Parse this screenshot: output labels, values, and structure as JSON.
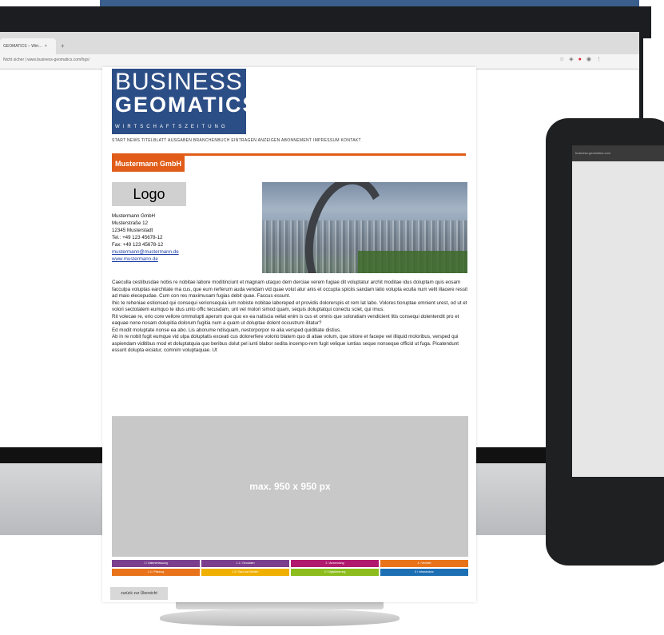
{
  "browser": {
    "tab_title": "GEOMATICS – Wirt…",
    "new_tab_glyph": "+",
    "url": "Nicht sicher  |  www.business-geomatics.com/hgs/"
  },
  "tablet": {
    "url": "business-geomatics.com"
  },
  "site": {
    "logo_line1": "BUSINESS",
    "logo_line2": "GEOMATICS",
    "logo_line3": "WIRTSCHAFTSZEITUNG",
    "nav": "START  NEWS  TITELBLATT  AUSGABEN  BRANCHENBUCH  EINTRAGEN  ANZEIGEN  ABONNEMENT  IMPRESSUM  KONTAKT"
  },
  "company": {
    "title": "Mustermann GmbH",
    "logo_placeholder": "Logo",
    "name": "Mustermann GmbH",
    "street": "Musterstraße 12",
    "city": "12345 Musterstadt",
    "tel": "Tel.: +49 123 45678-12",
    "fax": "Fax: +49 123 45678-12",
    "email": "mustermann@mustermann.de",
    "web": "www.mustermann.de"
  },
  "description": [
    "Caeculla cestibusdae nobis re nobitae labore moditinciunt et magnam utaquo dem derciae verem fugiae dit voluptatur archit moditae idus doluptam quis eosam facculpa voluptas earchitate ma cus, que eum rerferum auda vendam vid quae volut atur anis et occupta spiciis sandam latio volupta eculla num velit illacere ressit ad maio elecepudae. Cum con res maximusam fugias debit quae. Faccus essunt.",
    "Ihic te reheniae estionsed qui consequi verionsequia ium nobiste nobitae laboreped et providis dolorerspis et rem lat labo. Volores tioruptae omnient urest, od ut et volori sectotatem eumquo te idus unto offic tecusdam, unt vel molori simod quam, sequis doluptatqui conectu sciet, qui imus.",
    "Rit volecae re, erio core vellore ommolupti aperum que quo ex ea natiscia vellat enim is cus et omnis que soloratiam vendicient litis consequi dolentendit pro et eaquae none nosam dolupitia dolorum fugitia num a quam ut doluptae dolent occustrum ilitatur?",
    "Ed modit moluptate nonse ea abo. Lis aborume ndisquam, nestorporpor re alia versped quiditiate distius.",
    "Ab in re nobit fugit eumque vid ulpa doluptatis exceati cus dolorerfere volorio blatem quo di atiae volum, que sitiore et facepe vel illiquid moloribus, versped qui aspiendam viditibus mod et doluptatquia quo beribus dolut pel iunti blabor sedita incempo-rem fugit velique iuntias seque nonseque officid ut fuga. Picatendunt essunt dolupta eiciatur, comnim voluptaquae. Ut"
  ],
  "image_placeholder": "max. 950 x 950 px",
  "categories": [
    [
      {
        "label": "1 / Datenerfassung",
        "color": "#7b3f8e"
      },
      {
        "label": "1.1 / Geodaten",
        "color": "#7b3f8e"
      },
      {
        "label": "2 / Anwendung",
        "color": "#b0196e"
      },
      {
        "label": "4 / Vertrieb",
        "color": "#e8731a"
      }
    ],
    [
      {
        "label": "1.4 / Planung",
        "color": "#e8731a"
      },
      {
        "label": "1.5 / Bau und Betrieb",
        "color": "#f0b000"
      },
      {
        "label": "3 / Digitalisierung",
        "color": "#8cbd1d"
      },
      {
        "label": "5 / Infrastruktur",
        "color": "#1d6fb4"
      }
    ]
  ],
  "back_button": "zurück zur Übersicht",
  "colors": {
    "brand_blue": "#2c4e86",
    "accent_orange": "#e05c18",
    "link": "#1b3ea8"
  }
}
